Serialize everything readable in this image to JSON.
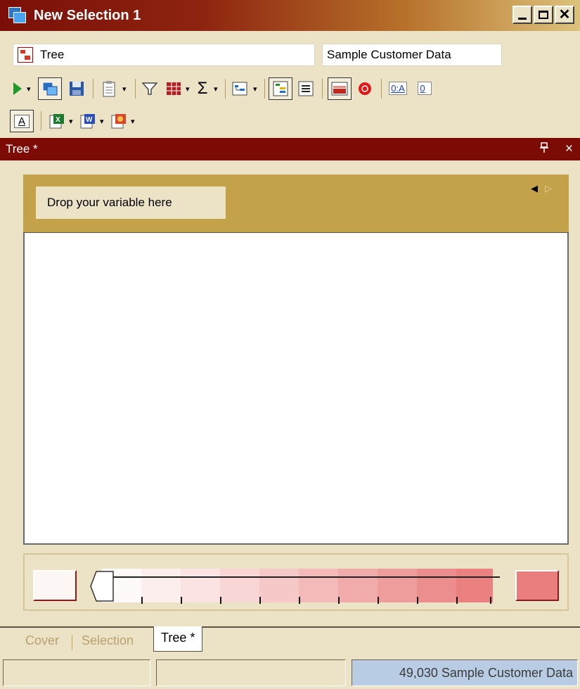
{
  "window": {
    "title": "New Selection 1"
  },
  "fields": {
    "view_name": "Tree",
    "dataset_name": "Sample Customer Data"
  },
  "toolbar": {
    "icons": [
      "play-icon",
      "copy-window-icon",
      "save-icon",
      "clipboard-icon",
      "filter-icon",
      "grid-icon",
      "sigma-icon",
      "decision-tree-icon",
      "tree-view-icon",
      "list-view-icon",
      "chart-icon",
      "stop-icon",
      "zero-a-icon",
      "zero-icon",
      "text-a-icon",
      "excel-icon",
      "word-icon",
      "powerpoint-icon"
    ],
    "sigma": "Σ",
    "zero_a_label": "0:A",
    "zero_label": "0",
    "a_label": "A"
  },
  "pane": {
    "title": "Tree *",
    "pin": "⊣",
    "close": "×"
  },
  "dropzone": {
    "label": "Drop your variable here"
  },
  "legend": {
    "low_color": "#fcf6f4",
    "high_color": "#ea7d7d"
  },
  "tabs": {
    "items": [
      "Cover",
      "Selection"
    ],
    "active": "Tree *"
  },
  "status": {
    "record_info": "49,030 Sample Customer Data"
  }
}
